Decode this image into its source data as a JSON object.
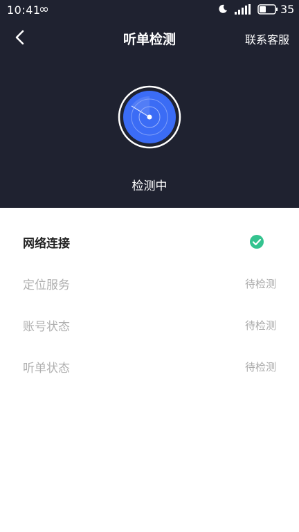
{
  "status_bar": {
    "time": "10:41",
    "battery": "35"
  },
  "nav": {
    "title": "听单检测",
    "contact": "联系客服"
  },
  "scan": {
    "status": "检测中"
  },
  "checks": [
    {
      "label": "网络连接",
      "state": "done",
      "status": ""
    },
    {
      "label": "定位服务",
      "state": "pending",
      "status": "待检测"
    },
    {
      "label": "账号状态",
      "state": "pending",
      "status": "待检测"
    },
    {
      "label": "听单状态",
      "state": "pending",
      "status": "待检测"
    }
  ],
  "colors": {
    "header_bg": "#1f2230",
    "radar_blue": "#3b6cf5",
    "success_green": "#34c38f"
  }
}
